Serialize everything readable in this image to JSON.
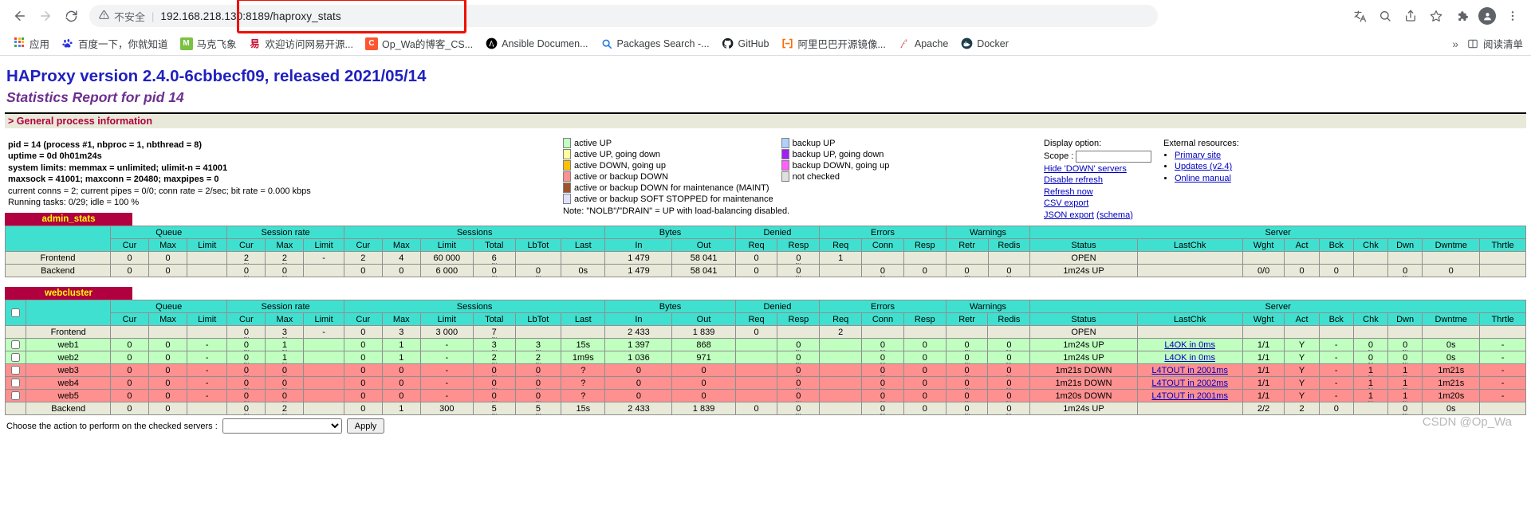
{
  "browser": {
    "nav": {
      "back": "←",
      "forward": "→",
      "reload": "⟳"
    },
    "omnibox": {
      "security_label": "不安全",
      "url": "192.168.218.130:8189/haproxy_stats",
      "separator": "|"
    },
    "bookmarks": [
      {
        "label": "应用",
        "icon": "apps-grid-icon"
      },
      {
        "label": "百度一下，你就知道",
        "icon": "baidu-icon"
      },
      {
        "label": "马克飞象",
        "icon": "maxiang-icon"
      },
      {
        "label": "欢迎访问网易开源...",
        "icon": "netease-icon"
      },
      {
        "label": "Op_Wa的博客_CS...",
        "icon": "csdn-icon"
      },
      {
        "label": "Ansible Documen...",
        "icon": "ansible-icon"
      },
      {
        "label": "Packages Search -...",
        "icon": "search-icon"
      },
      {
        "label": "GitHub",
        "icon": "github-icon"
      },
      {
        "label": "阿里巴巴开源镜像...",
        "icon": "aliyun-icon"
      },
      {
        "label": "Apache",
        "icon": "apache-icon"
      },
      {
        "label": "Docker",
        "icon": "docker-icon"
      }
    ],
    "bookmarks_overflow": "»",
    "reading_list": "阅读清单"
  },
  "haproxy": {
    "title": "HAProxy version 2.4.0-6cbbecf09, released 2021/05/14",
    "subtitle": "Statistics Report for pid 14",
    "section_header": "> General process information",
    "process_info": [
      "pid = 14 (process #1, nbproc = 1, nbthread = 8)",
      "uptime = 0d 0h01m24s",
      "system limits: memmax = unlimited; ulimit-n = 41001",
      "maxsock = 41001; maxconn = 20480; maxpipes = 0",
      "current conns = 2; current pipes = 0/0; conn rate = 2/sec; bit rate = 0.000 kbps",
      "Running tasks: 0/29; idle = 100 %"
    ],
    "legend": {
      "left": [
        {
          "label": "active UP",
          "color": "#c0ffc0"
        },
        {
          "label": "active UP, going down",
          "color": "#ffffa0"
        },
        {
          "label": "active DOWN, going up",
          "color": "#ffc000"
        },
        {
          "label": "active or backup DOWN",
          "color": "#ff9090"
        },
        {
          "label": "active or backup DOWN for maintenance (MAINT)",
          "color": "#a0522d"
        },
        {
          "label": "active or backup SOFT STOPPED for maintenance",
          "color": "#e0e0ff"
        }
      ],
      "right": [
        {
          "label": "backup UP",
          "color": "#b0d0ff"
        },
        {
          "label": "backup UP, going down",
          "color": "#a020f0"
        },
        {
          "label": "backup DOWN, going up",
          "color": "#ff60ff"
        },
        {
          "label": "not checked",
          "color": "#e0e0e0"
        }
      ],
      "note": "Note: \"NOLB\"/\"DRAIN\" = UP with load-balancing disabled."
    },
    "display_option": {
      "heading": "Display option:",
      "scope_label": "Scope :",
      "scope_value": "",
      "links": [
        "Hide 'DOWN' servers",
        "Disable refresh",
        "Refresh now",
        "CSV export",
        "JSON export"
      ],
      "json_schema_label": "(schema)"
    },
    "external_resources": {
      "heading": "External resources:",
      "links": [
        "Primary site",
        "Updates (v2.4)",
        "Online manual"
      ]
    },
    "column_groups": [
      "Queue",
      "Session rate",
      "Sessions",
      "Bytes",
      "Denied",
      "Errors",
      "Warnings",
      "Server"
    ],
    "columns": {
      "queue": [
        "Cur",
        "Max",
        "Limit"
      ],
      "session_rate": [
        "Cur",
        "Max",
        "Limit"
      ],
      "sessions": [
        "Cur",
        "Max",
        "Limit",
        "Total",
        "LbTot",
        "Last"
      ],
      "bytes": [
        "In",
        "Out"
      ],
      "denied": [
        "Req",
        "Resp"
      ],
      "errors": [
        "Req",
        "Conn",
        "Resp"
      ],
      "warnings": [
        "Retr",
        "Redis"
      ],
      "server": [
        "Status",
        "LastChk",
        "Wght",
        "Act",
        "Bck",
        "Chk",
        "Dwn",
        "Dwntme",
        "Thrtle"
      ]
    },
    "proxies": [
      {
        "name": "admin_stats",
        "has_checkboxes": false,
        "rows": [
          {
            "name": "Frontend",
            "type": "frontend",
            "style": "beige",
            "q_cur": "0",
            "q_max": "0",
            "q_limit": "",
            "sr_cur": "2",
            "sr_max": "2",
            "sr_limit": "-",
            "s_cur": "2",
            "s_max": "4",
            "s_limit": "60 000",
            "s_total": "6",
            "s_lbtot": "",
            "s_last": "",
            "b_in": "1 479",
            "b_out": "58 041",
            "d_req": "0",
            "d_resp": "0",
            "e_req": "1",
            "e_conn": "",
            "e_resp": "",
            "w_retr": "",
            "w_redis": "",
            "status": "OPEN",
            "lastchk": "",
            "wght": "",
            "act": "",
            "bck": "",
            "chk": "",
            "dwn": "",
            "dwntme": "",
            "thrtle": ""
          },
          {
            "name": "Backend",
            "type": "backend",
            "style": "beige",
            "q_cur": "0",
            "q_max": "0",
            "q_limit": "",
            "sr_cur": "0",
            "sr_max": "0",
            "sr_limit": "",
            "s_cur": "0",
            "s_max": "0",
            "s_limit": "6 000",
            "s_total": "0",
            "s_lbtot": "0",
            "s_last": "0s",
            "b_in": "1 479",
            "b_out": "58 041",
            "d_req": "0",
            "d_resp": "0",
            "e_req": "",
            "e_conn": "0",
            "e_resp": "0",
            "w_retr": "0",
            "w_redis": "0",
            "status": "1m24s UP",
            "lastchk": "",
            "wght": "0/0",
            "act": "0",
            "bck": "0",
            "chk": "",
            "dwn": "0",
            "dwntme": "0",
            "thrtle": ""
          }
        ]
      },
      {
        "name": "webcluster",
        "has_checkboxes": true,
        "rows": [
          {
            "name": "Frontend",
            "type": "frontend",
            "style": "beige",
            "checkbox": false,
            "q_cur": "",
            "q_max": "",
            "q_limit": "",
            "sr_cur": "0",
            "sr_max": "3",
            "sr_limit": "-",
            "s_cur": "0",
            "s_max": "3",
            "s_limit": "3 000",
            "s_total": "7",
            "s_lbtot": "",
            "s_last": "",
            "b_in": "2 433",
            "b_out": "1 839",
            "d_req": "0",
            "d_resp": "",
            "e_req": "2",
            "e_conn": "",
            "e_resp": "",
            "w_retr": "",
            "w_redis": "",
            "status": "OPEN",
            "lastchk": "",
            "wght": "",
            "act": "",
            "bck": "",
            "chk": "",
            "dwn": "",
            "dwntme": "",
            "thrtle": ""
          },
          {
            "name": "web1",
            "type": "server",
            "style": "up",
            "checkbox": true,
            "q_cur": "0",
            "q_max": "0",
            "q_limit": "-",
            "sr_cur": "0",
            "sr_max": "1",
            "sr_limit": "",
            "s_cur": "0",
            "s_max": "1",
            "s_limit": "-",
            "s_total": "3",
            "s_lbtot": "3",
            "s_last": "15s",
            "b_in": "1 397",
            "b_out": "868",
            "d_req": "",
            "d_resp": "0",
            "e_req": "",
            "e_conn": "0",
            "e_resp": "0",
            "w_retr": "0",
            "w_redis": "0",
            "status": "1m24s UP",
            "lastchk": "L4OK in 0ms",
            "wght": "1/1",
            "act": "Y",
            "bck": "-",
            "chk": "0",
            "dwn": "0",
            "dwntme": "0s",
            "thrtle": "-"
          },
          {
            "name": "web2",
            "type": "server",
            "style": "up",
            "checkbox": true,
            "q_cur": "0",
            "q_max": "0",
            "q_limit": "-",
            "sr_cur": "0",
            "sr_max": "1",
            "sr_limit": "",
            "s_cur": "0",
            "s_max": "1",
            "s_limit": "-",
            "s_total": "2",
            "s_lbtot": "2",
            "s_last": "1m9s",
            "b_in": "1 036",
            "b_out": "971",
            "d_req": "",
            "d_resp": "0",
            "e_req": "",
            "e_conn": "0",
            "e_resp": "0",
            "w_retr": "0",
            "w_redis": "0",
            "status": "1m24s UP",
            "lastchk": "L4OK in 0ms",
            "wght": "1/1",
            "act": "Y",
            "bck": "-",
            "chk": "0",
            "dwn": "0",
            "dwntme": "0s",
            "thrtle": "-"
          },
          {
            "name": "web3",
            "type": "server",
            "style": "down",
            "checkbox": true,
            "q_cur": "0",
            "q_max": "0",
            "q_limit": "-",
            "sr_cur": "0",
            "sr_max": "0",
            "sr_limit": "",
            "s_cur": "0",
            "s_max": "0",
            "s_limit": "-",
            "s_total": "0",
            "s_lbtot": "0",
            "s_last": "?",
            "b_in": "0",
            "b_out": "0",
            "d_req": "",
            "d_resp": "0",
            "e_req": "",
            "e_conn": "0",
            "e_resp": "0",
            "w_retr": "0",
            "w_redis": "0",
            "status": "1m21s DOWN",
            "lastchk": "L4TOUT in 2001ms",
            "wght": "1/1",
            "act": "Y",
            "bck": "-",
            "chk": "1",
            "dwn": "1",
            "dwntme": "1m21s",
            "thrtle": "-"
          },
          {
            "name": "web4",
            "type": "server",
            "style": "down",
            "checkbox": true,
            "q_cur": "0",
            "q_max": "0",
            "q_limit": "-",
            "sr_cur": "0",
            "sr_max": "0",
            "sr_limit": "",
            "s_cur": "0",
            "s_max": "0",
            "s_limit": "-",
            "s_total": "0",
            "s_lbtot": "0",
            "s_last": "?",
            "b_in": "0",
            "b_out": "0",
            "d_req": "",
            "d_resp": "0",
            "e_req": "",
            "e_conn": "0",
            "e_resp": "0",
            "w_retr": "0",
            "w_redis": "0",
            "status": "1m21s DOWN",
            "lastchk": "L4TOUT in 2002ms",
            "wght": "1/1",
            "act": "Y",
            "bck": "-",
            "chk": "1",
            "dwn": "1",
            "dwntme": "1m21s",
            "thrtle": "-"
          },
          {
            "name": "web5",
            "type": "server",
            "style": "down",
            "checkbox": true,
            "q_cur": "0",
            "q_max": "0",
            "q_limit": "-",
            "sr_cur": "0",
            "sr_max": "0",
            "sr_limit": "",
            "s_cur": "0",
            "s_max": "0",
            "s_limit": "-",
            "s_total": "0",
            "s_lbtot": "0",
            "s_last": "?",
            "b_in": "0",
            "b_out": "0",
            "d_req": "",
            "d_resp": "0",
            "e_req": "",
            "e_conn": "0",
            "e_resp": "0",
            "w_retr": "0",
            "w_redis": "0",
            "status": "1m20s DOWN",
            "lastchk": "L4TOUT in 2001ms",
            "wght": "1/1",
            "act": "Y",
            "bck": "-",
            "chk": "1",
            "dwn": "1",
            "dwntme": "1m20s",
            "thrtle": "-"
          },
          {
            "name": "Backend",
            "type": "backend",
            "style": "beige",
            "checkbox": false,
            "q_cur": "0",
            "q_max": "0",
            "q_limit": "",
            "sr_cur": "0",
            "sr_max": "2",
            "sr_limit": "",
            "s_cur": "0",
            "s_max": "1",
            "s_limit": "300",
            "s_total": "5",
            "s_lbtot": "5",
            "s_last": "15s",
            "b_in": "2 433",
            "b_out": "1 839",
            "d_req": "0",
            "d_resp": "0",
            "e_req": "",
            "e_conn": "0",
            "e_resp": "0",
            "w_retr": "0",
            "w_redis": "0",
            "status": "1m24s UP",
            "lastchk": "",
            "wght": "2/2",
            "act": "2",
            "bck": "0",
            "chk": "",
            "dwn": "0",
            "dwntme": "0s",
            "thrtle": ""
          }
        ]
      }
    ],
    "action_bar": {
      "label": "Choose the action to perform on the checked servers :",
      "selected_option": "",
      "apply_label": "Apply"
    },
    "watermark": "CSDN @Op_Wa"
  }
}
